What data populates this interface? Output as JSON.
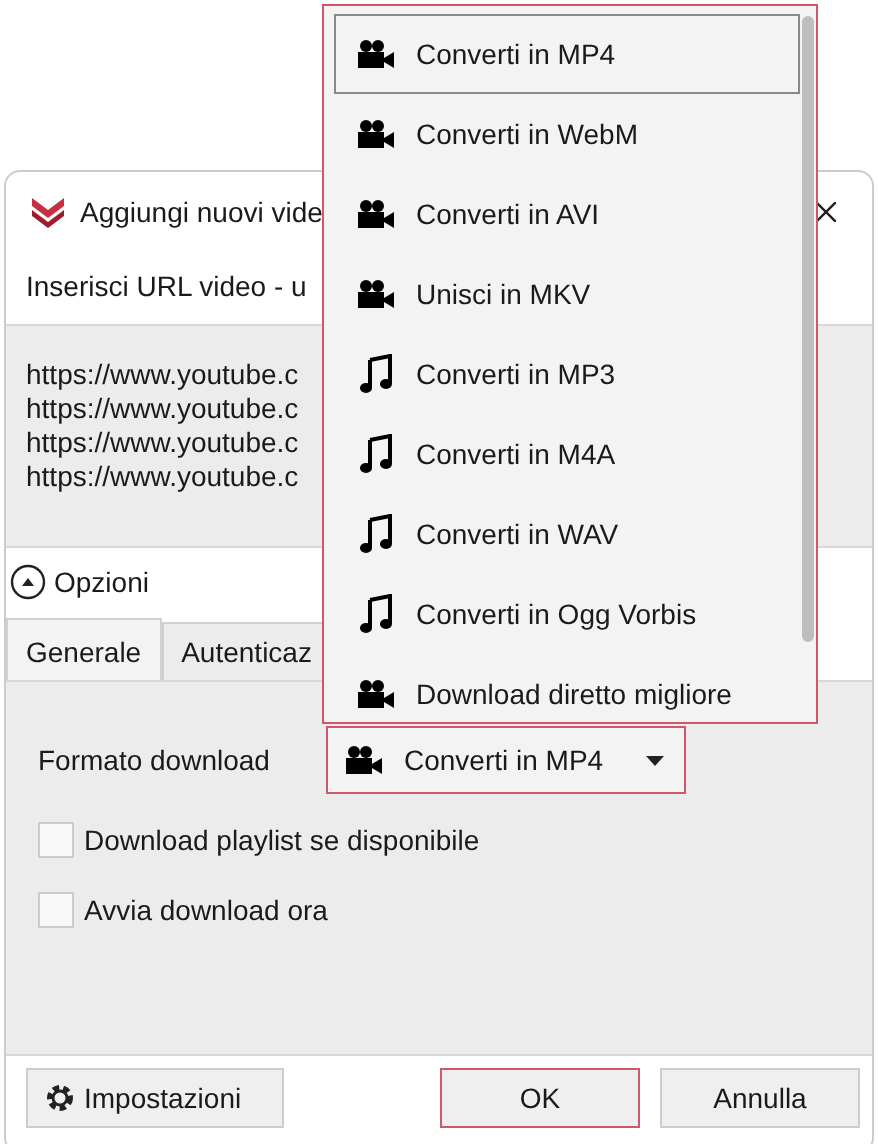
{
  "dialog": {
    "title": "Aggiungi nuovi vide",
    "instruction": "Inserisci URL video - u",
    "urls": [
      "https://www.youtube.c",
      "https://www.youtube.c",
      "https://www.youtube.c",
      "https://www.youtube.c"
    ],
    "options": {
      "label": "Opzioni",
      "expanded": true
    },
    "tabs": [
      {
        "label": "Generale",
        "selected": true
      },
      {
        "label": "Autenticaz",
        "selected": false
      }
    ],
    "format": {
      "label": "Formato download",
      "value": "Converti in MP4",
      "kind": "video"
    },
    "checkboxes": [
      {
        "label": "Download playlist se disponibile",
        "checked": false
      },
      {
        "label": "Avvia download ora",
        "checked": false
      }
    ],
    "buttons": {
      "settings": "Impostazioni",
      "ok": "OK",
      "cancel": "Annulla"
    }
  },
  "menu": [
    {
      "label": "Converti in MP4",
      "kind": "video",
      "selected": true
    },
    {
      "label": "Converti in WebM",
      "kind": "video",
      "selected": false
    },
    {
      "label": "Converti in AVI",
      "kind": "video",
      "selected": false
    },
    {
      "label": "Unisci in MKV",
      "kind": "video",
      "selected": false
    },
    {
      "label": "Converti in MP3",
      "kind": "audio",
      "selected": false
    },
    {
      "label": "Converti in M4A",
      "kind": "audio",
      "selected": false
    },
    {
      "label": "Converti in WAV",
      "kind": "audio",
      "selected": false
    },
    {
      "label": "Converti in Ogg Vorbis",
      "kind": "audio",
      "selected": false
    },
    {
      "label": "Download diretto migliore",
      "kind": "video",
      "selected": false
    }
  ]
}
